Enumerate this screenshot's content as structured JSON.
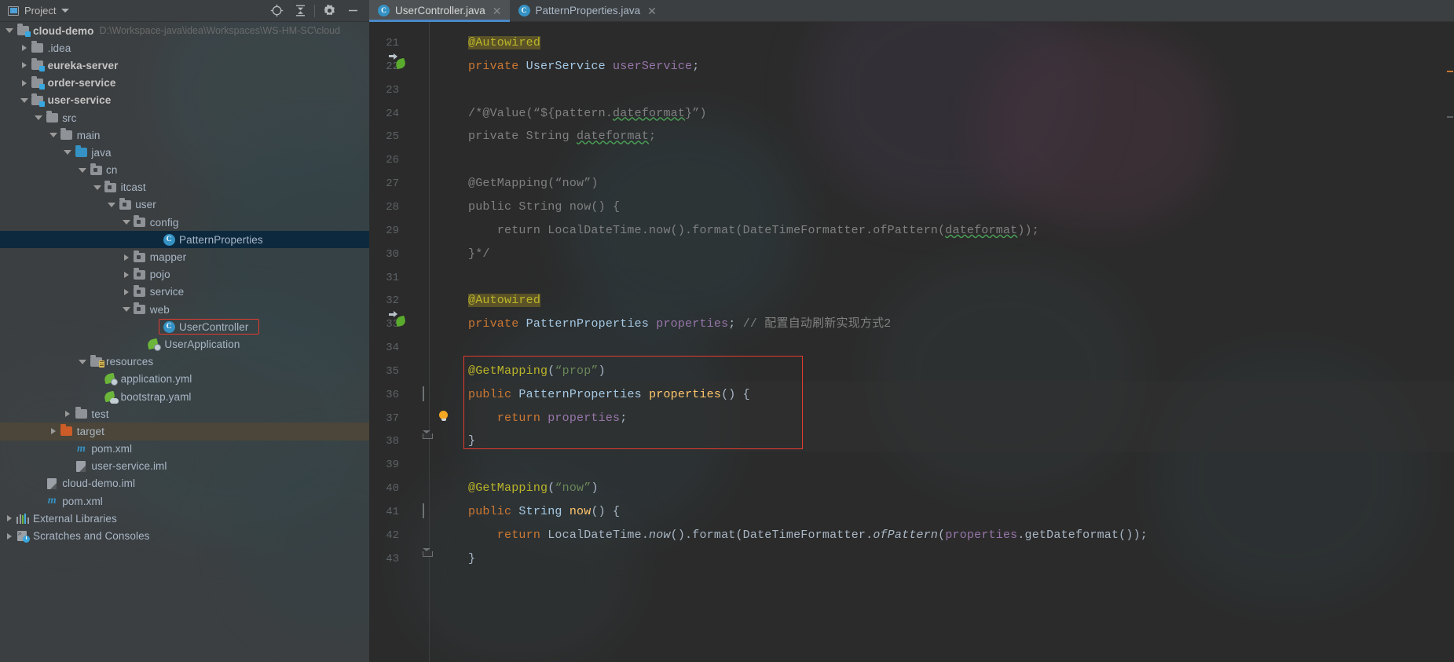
{
  "window": {
    "project_tool_label": "Project",
    "toolbar_icons": [
      "locate-icon",
      "collapse-all-icon",
      "settings-icon",
      "hide-icon"
    ]
  },
  "tabs": [
    {
      "label": "UserController.java",
      "icon": "java-class-icon",
      "active": true,
      "closable": true
    },
    {
      "label": "PatternProperties.java",
      "icon": "java-class-icon",
      "active": false,
      "closable": true
    }
  ],
  "sidebar": {
    "items": [
      {
        "label": "cloud-demo",
        "path": "D:\\Workspace-java\\idea\\Workspaces\\WS-HM-SC\\cloud",
        "indent": 0,
        "arrow": "open",
        "icon": "module-folder-icon",
        "bold": true
      },
      {
        "label": ".idea",
        "indent": 1,
        "arrow": "closed",
        "icon": "folder-icon"
      },
      {
        "label": "eureka-server",
        "indent": 1,
        "arrow": "closed",
        "icon": "module-folder-icon",
        "bold": true
      },
      {
        "label": "order-service",
        "indent": 1,
        "arrow": "closed",
        "icon": "module-folder-icon",
        "bold": true
      },
      {
        "label": "user-service",
        "indent": 1,
        "arrow": "open",
        "icon": "module-folder-icon",
        "bold": true
      },
      {
        "label": "src",
        "indent": 2,
        "arrow": "open",
        "icon": "folder-icon"
      },
      {
        "label": "main",
        "indent": 3,
        "arrow": "open",
        "icon": "folder-icon"
      },
      {
        "label": "java",
        "indent": 4,
        "arrow": "open",
        "icon": "source-root-folder-icon"
      },
      {
        "label": "cn",
        "indent": 5,
        "arrow": "open",
        "icon": "package-folder-icon"
      },
      {
        "label": "itcast",
        "indent": 6,
        "arrow": "open",
        "icon": "package-folder-icon"
      },
      {
        "label": "user",
        "indent": 7,
        "arrow": "open",
        "icon": "package-folder-icon"
      },
      {
        "label": "config",
        "indent": 8,
        "arrow": "open",
        "icon": "package-folder-icon"
      },
      {
        "label": "PatternProperties",
        "indent": 10,
        "arrow": "none",
        "icon": "java-class-icon",
        "selected": true
      },
      {
        "label": "mapper",
        "indent": 8,
        "arrow": "closed",
        "icon": "package-folder-icon"
      },
      {
        "label": "pojo",
        "indent": 8,
        "arrow": "closed",
        "icon": "package-folder-icon"
      },
      {
        "label": "service",
        "indent": 8,
        "arrow": "closed",
        "icon": "package-folder-icon"
      },
      {
        "label": "web",
        "indent": 8,
        "arrow": "open",
        "icon": "package-folder-icon"
      },
      {
        "label": "UserController",
        "indent": 10,
        "arrow": "none",
        "icon": "java-class-icon",
        "annotated": true
      },
      {
        "label": "UserApplication",
        "indent": 9,
        "arrow": "none",
        "icon": "spring-run-icon"
      },
      {
        "label": "resources",
        "indent": 5,
        "arrow": "open",
        "icon": "resource-folder-icon"
      },
      {
        "label": "application.yml",
        "indent": 6,
        "arrow": "none",
        "icon": "spring-yaml-icon"
      },
      {
        "label": "bootstrap.yaml",
        "indent": 6,
        "arrow": "none",
        "icon": "spring-cloud-yaml-icon"
      },
      {
        "label": "test",
        "indent": 4,
        "arrow": "closed",
        "icon": "folder-icon"
      },
      {
        "label": "target",
        "indent": 3,
        "arrow": "closed",
        "icon": "excluded-folder-icon",
        "highlighted": true
      },
      {
        "label": "pom.xml",
        "indent": 4,
        "arrow": "none",
        "icon": "maven-icon"
      },
      {
        "label": "user-service.iml",
        "indent": 4,
        "arrow": "none",
        "icon": "iml-file-icon"
      },
      {
        "label": "cloud-demo.iml",
        "indent": 2,
        "arrow": "none",
        "icon": "iml-file-icon"
      },
      {
        "label": "pom.xml",
        "indent": 2,
        "arrow": "none",
        "icon": "maven-icon"
      },
      {
        "label": "External Libraries",
        "indent": 0,
        "arrow": "closed",
        "icon": "external-libraries-icon"
      },
      {
        "label": "Scratches and Consoles",
        "indent": 0,
        "arrow": "closed",
        "icon": "scratches-icon"
      }
    ]
  },
  "editor": {
    "first_line": 21,
    "lines": [
      {
        "n": 21,
        "gutter": "none",
        "tokens": [
          {
            "t": "@Autowired",
            "c": "ann-hl"
          }
        ]
      },
      {
        "n": 22,
        "gutter": "bean",
        "tokens": [
          {
            "t": "private ",
            "c": "kw"
          },
          {
            "t": "UserService ",
            "c": "type"
          },
          {
            "t": "userService",
            "c": "fld"
          },
          {
            "t": ";",
            "c": "plain"
          }
        ]
      },
      {
        "n": 23,
        "gutter": "none",
        "tokens": []
      },
      {
        "n": 24,
        "gutter": "none",
        "tokens": [
          {
            "t": "/*@Value(“${pattern.",
            "c": "cmt"
          },
          {
            "t": "dateformat",
            "c": "cmt-squig"
          },
          {
            "t": "}”)",
            "c": "cmt"
          }
        ]
      },
      {
        "n": 25,
        "gutter": "none",
        "tokens": [
          {
            "t": "private String ",
            "c": "cmt"
          },
          {
            "t": "dateformat",
            "c": "cmt-squig"
          },
          {
            "t": ";",
            "c": "cmt"
          }
        ]
      },
      {
        "n": 26,
        "gutter": "none",
        "tokens": []
      },
      {
        "n": 27,
        "gutter": "none",
        "tokens": [
          {
            "t": "@GetMapping(“now”)",
            "c": "cmt"
          }
        ]
      },
      {
        "n": 28,
        "gutter": "none",
        "tokens": [
          {
            "t": "public String now() {",
            "c": "cmt"
          }
        ]
      },
      {
        "n": 29,
        "gutter": "none",
        "tokens": [
          {
            "t": "    return LocalDateTime.now().format(DateTimeFormatter.ofPattern(",
            "c": "cmt"
          },
          {
            "t": "dateformat",
            "c": "cmt-squig"
          },
          {
            "t": "));",
            "c": "cmt"
          }
        ]
      },
      {
        "n": 30,
        "gutter": "none",
        "tokens": [
          {
            "t": "}*/",
            "c": "cmt"
          }
        ]
      },
      {
        "n": 31,
        "gutter": "none",
        "tokens": []
      },
      {
        "n": 32,
        "gutter": "none",
        "tokens": [
          {
            "t": "@Autowired",
            "c": "ann-hl"
          }
        ]
      },
      {
        "n": 33,
        "gutter": "bean",
        "tokens": [
          {
            "t": "private ",
            "c": "kw"
          },
          {
            "t": "PatternProperties ",
            "c": "type"
          },
          {
            "t": "properties",
            "c": "fld"
          },
          {
            "t": "; ",
            "c": "plain"
          },
          {
            "t": "// 配置自动刷新实现方式2",
            "c": "cmt"
          }
        ]
      },
      {
        "n": 34,
        "gutter": "none",
        "tokens": []
      },
      {
        "n": 35,
        "gutter": "none",
        "tokens": [
          {
            "t": "@GetMapping",
            "c": "ann"
          },
          {
            "t": "(",
            "c": "plain"
          },
          {
            "t": "“prop”",
            "c": "str"
          },
          {
            "t": ")",
            "c": "plain"
          }
        ]
      },
      {
        "n": 36,
        "gutter": "fold-open",
        "tokens": [
          {
            "t": "public ",
            "c": "kw"
          },
          {
            "t": "PatternProperties ",
            "c": "type"
          },
          {
            "t": "properties",
            "c": "mth"
          },
          {
            "t": "() {",
            "c": "plain"
          }
        ]
      },
      {
        "n": 37,
        "gutter": "bulb",
        "tokens": [
          {
            "t": "    return ",
            "c": "kw"
          },
          {
            "t": "properties",
            "c": "fld"
          },
          {
            "t": ";",
            "c": "plain"
          }
        ]
      },
      {
        "n": 38,
        "gutter": "fold-close",
        "tokens": [
          {
            "t": "}",
            "c": "plain"
          }
        ]
      },
      {
        "n": 39,
        "gutter": "none",
        "tokens": []
      },
      {
        "n": 40,
        "gutter": "none",
        "tokens": [
          {
            "t": "@GetMapping",
            "c": "ann"
          },
          {
            "t": "(",
            "c": "plain"
          },
          {
            "t": "“now”",
            "c": "str"
          },
          {
            "t": ")",
            "c": "plain"
          }
        ]
      },
      {
        "n": 41,
        "gutter": "fold-open",
        "tokens": [
          {
            "t": "public ",
            "c": "kw"
          },
          {
            "t": "String ",
            "c": "type"
          },
          {
            "t": "now",
            "c": "mth"
          },
          {
            "t": "() {",
            "c": "plain"
          }
        ]
      },
      {
        "n": 42,
        "gutter": "none",
        "tokens": [
          {
            "t": "    return ",
            "c": "kw"
          },
          {
            "t": "LocalDateTime.",
            "c": "plain"
          },
          {
            "t": "now",
            "c": "stat"
          },
          {
            "t": "().format(DateTimeFormatter.",
            "c": "plain"
          },
          {
            "t": "ofPattern",
            "c": "stat"
          },
          {
            "t": "(",
            "c": "plain"
          },
          {
            "t": "properties",
            "c": "fld"
          },
          {
            "t": ".getDateformat());",
            "c": "plain"
          }
        ]
      },
      {
        "n": 43,
        "gutter": "fold-close",
        "tokens": [
          {
            "t": "}",
            "c": "plain"
          }
        ]
      }
    ]
  },
  "colors": {
    "annotation": "#bbb529",
    "keyword": "#cc7832",
    "type": "#a5c9e4",
    "field": "#9876aa",
    "string": "#6a8759",
    "comment": "#808080",
    "method": "#ffc66d",
    "plain": "#a9b7c6",
    "selection": "#0d293e",
    "annotation_box": "#e33b2e",
    "tab_active_underline": "#4a88c7",
    "editor_bg": "#2b2b2b",
    "panel_bg": "#3c3f41"
  }
}
